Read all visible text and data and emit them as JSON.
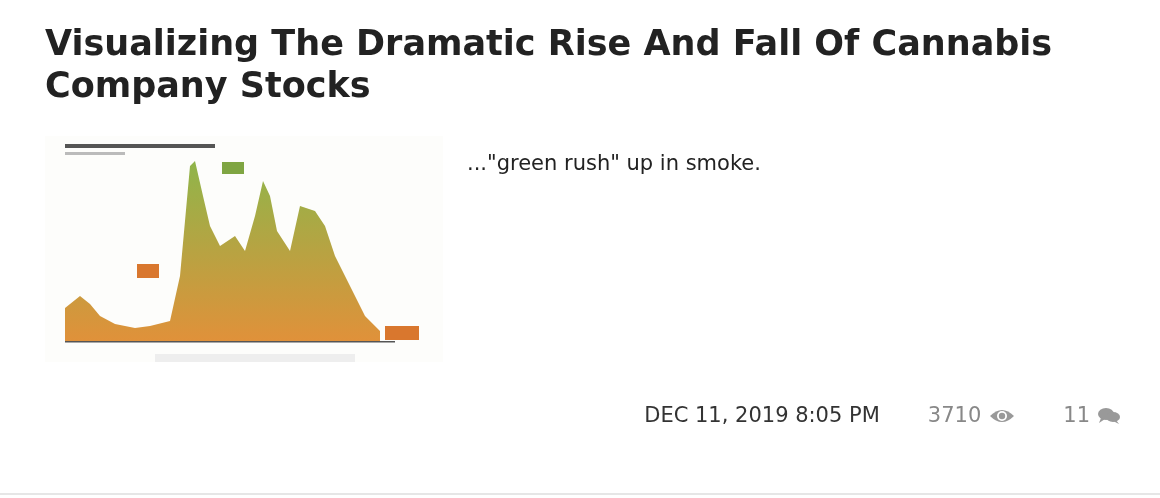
{
  "post": {
    "title": "Visualizing The Dramatic Rise And Fall Of Cannabis Company Stocks",
    "excerpt": "...\"green rush\" up in smoke.",
    "date": "DEC 11, 2019 8:05 PM",
    "views": "3710",
    "comments": "11"
  }
}
